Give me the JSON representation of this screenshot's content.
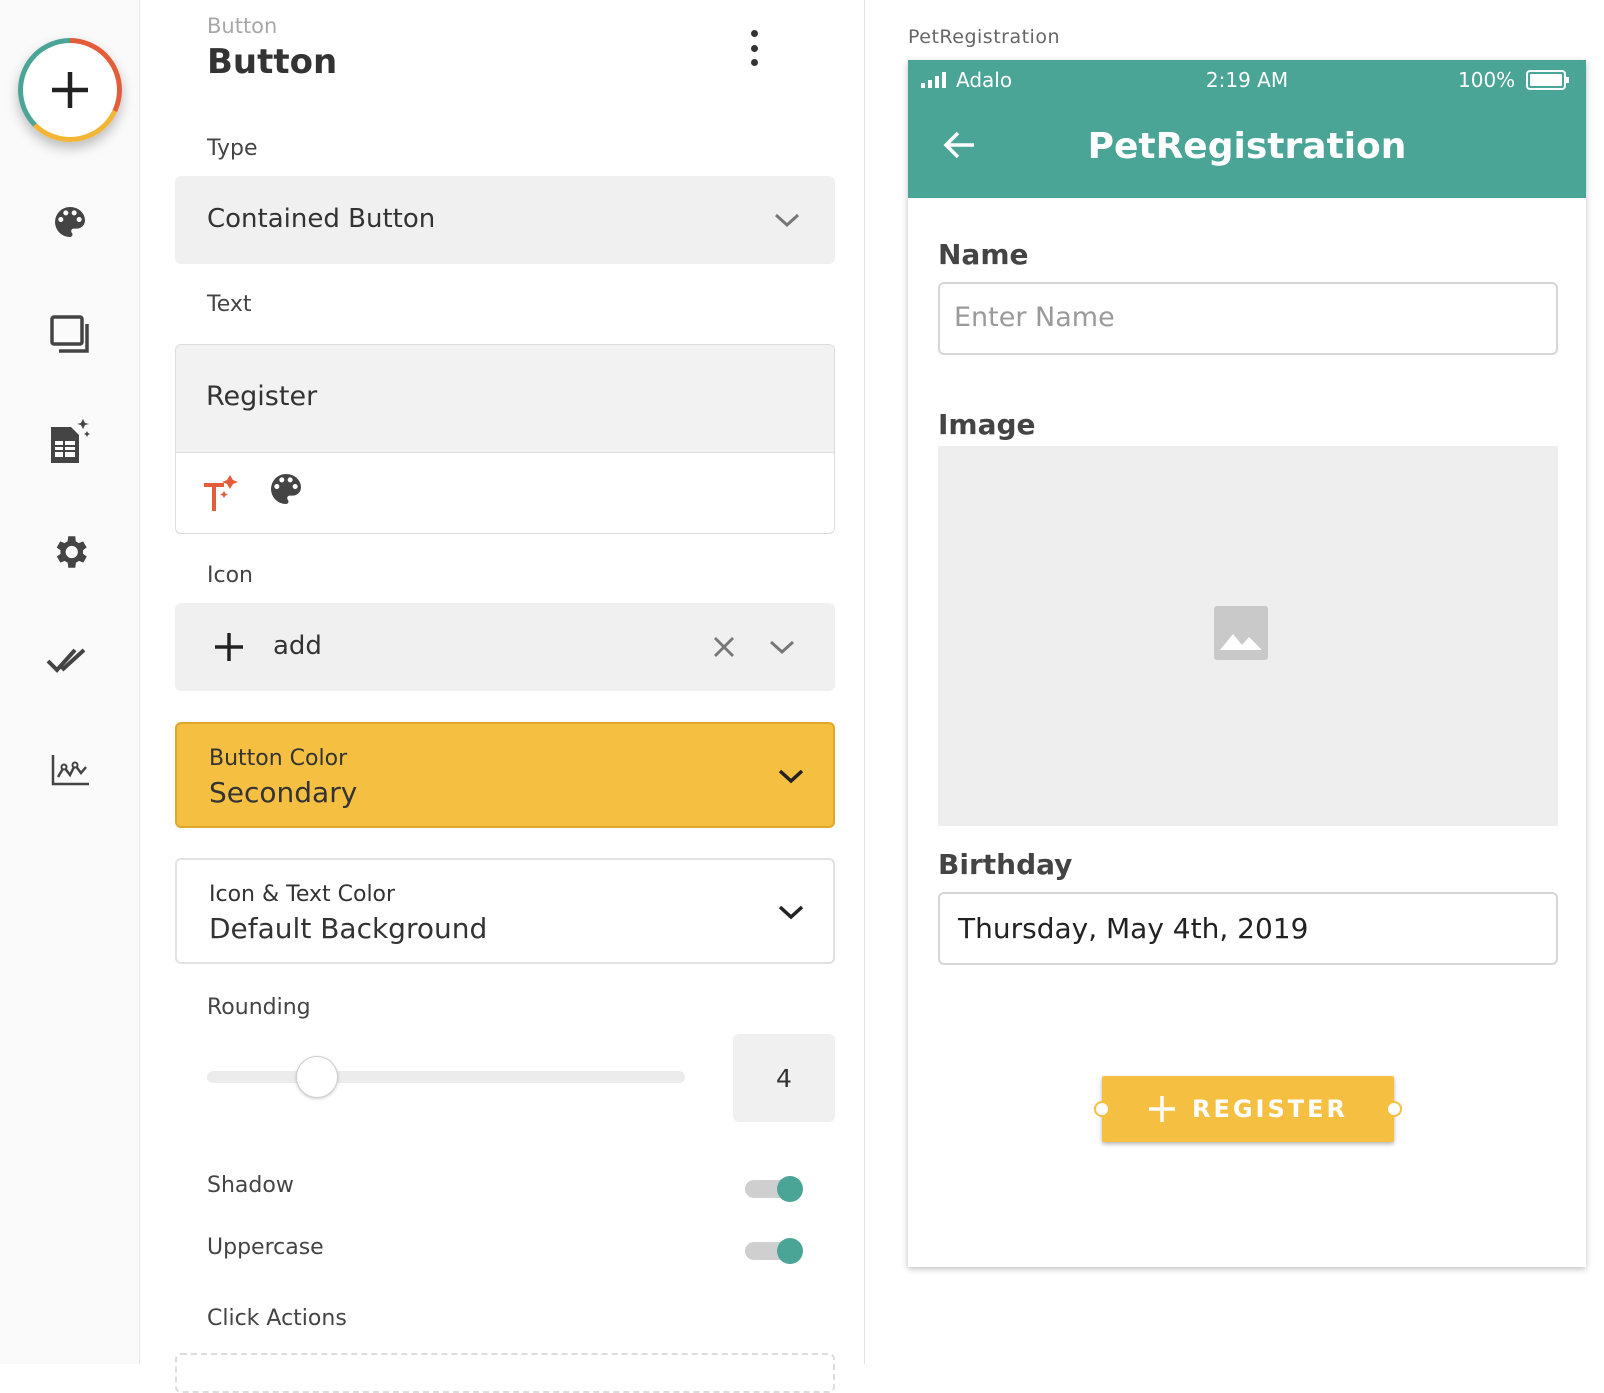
{
  "rail": {
    "icons": [
      "add-icon",
      "palette-icon",
      "screens-icon",
      "database-icon",
      "gear-icon",
      "publish-check-icon",
      "analytics-icon"
    ]
  },
  "panel": {
    "breadcrumb": "Button",
    "title": "Button",
    "type": {
      "label": "Type",
      "value": "Contained Button"
    },
    "text": {
      "label": "Text",
      "value": "Register"
    },
    "icon": {
      "label": "Icon",
      "value": "add"
    },
    "button_color": {
      "label": "Button Color",
      "value": "Secondary",
      "color": "#f5bf42"
    },
    "icon_text_color": {
      "label": "Icon & Text Color",
      "value": "Default Background"
    },
    "rounding": {
      "label": "Rounding",
      "value": "4",
      "fraction": 0.23
    },
    "shadow": {
      "label": "Shadow",
      "on": true
    },
    "uppercase": {
      "label": "Uppercase",
      "on": true
    },
    "click_actions": {
      "label": "Click Actions"
    }
  },
  "preview": {
    "screen_name": "PetRegistration",
    "status": {
      "carrier": "Adalo",
      "time": "2:19 AM",
      "battery": "100%"
    },
    "app_title": "PetRegistration",
    "name": {
      "label": "Name",
      "placeholder": "Enter Name"
    },
    "image": {
      "label": "Image"
    },
    "birthday": {
      "label": "Birthday",
      "value": "Thursday, May 4th, 2019"
    },
    "register_button": "REGISTER",
    "colors": {
      "primary": "#4aa596",
      "secondary": "#f5bf42"
    }
  }
}
